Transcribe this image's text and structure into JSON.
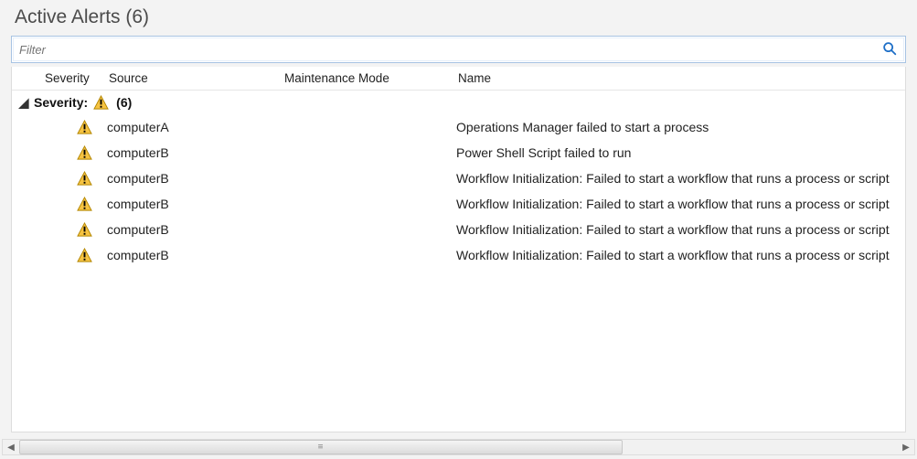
{
  "title": "Active Alerts (6)",
  "filter": {
    "placeholder": "Filter"
  },
  "columns": {
    "severity": "Severity",
    "source": "Source",
    "maintenance_mode": "Maintenance Mode",
    "name": "Name"
  },
  "group": {
    "caret": "◢",
    "label": "Severity:",
    "severity_icon": "warning",
    "count_label": "(6)"
  },
  "rows": [
    {
      "severity_icon": "warning",
      "source": "computerA",
      "maintenance_mode": "",
      "name": "Operations Manager failed to start a process"
    },
    {
      "severity_icon": "warning",
      "source": "computerB",
      "maintenance_mode": "",
      "name": "Power Shell Script failed to run"
    },
    {
      "severity_icon": "warning",
      "source": "computerB",
      "maintenance_mode": "",
      "name": "Workflow Initialization: Failed to start a workflow that runs a process or script"
    },
    {
      "severity_icon": "warning",
      "source": "computerB",
      "maintenance_mode": "",
      "name": "Workflow Initialization: Failed to start a workflow that runs a process or script"
    },
    {
      "severity_icon": "warning",
      "source": "computerB",
      "maintenance_mode": "",
      "name": "Workflow Initialization: Failed to start a workflow that runs a process or script"
    },
    {
      "severity_icon": "warning",
      "source": "computerB",
      "maintenance_mode": "",
      "name": "Workflow Initialization: Failed to start a workflow that runs a process or script"
    }
  ]
}
